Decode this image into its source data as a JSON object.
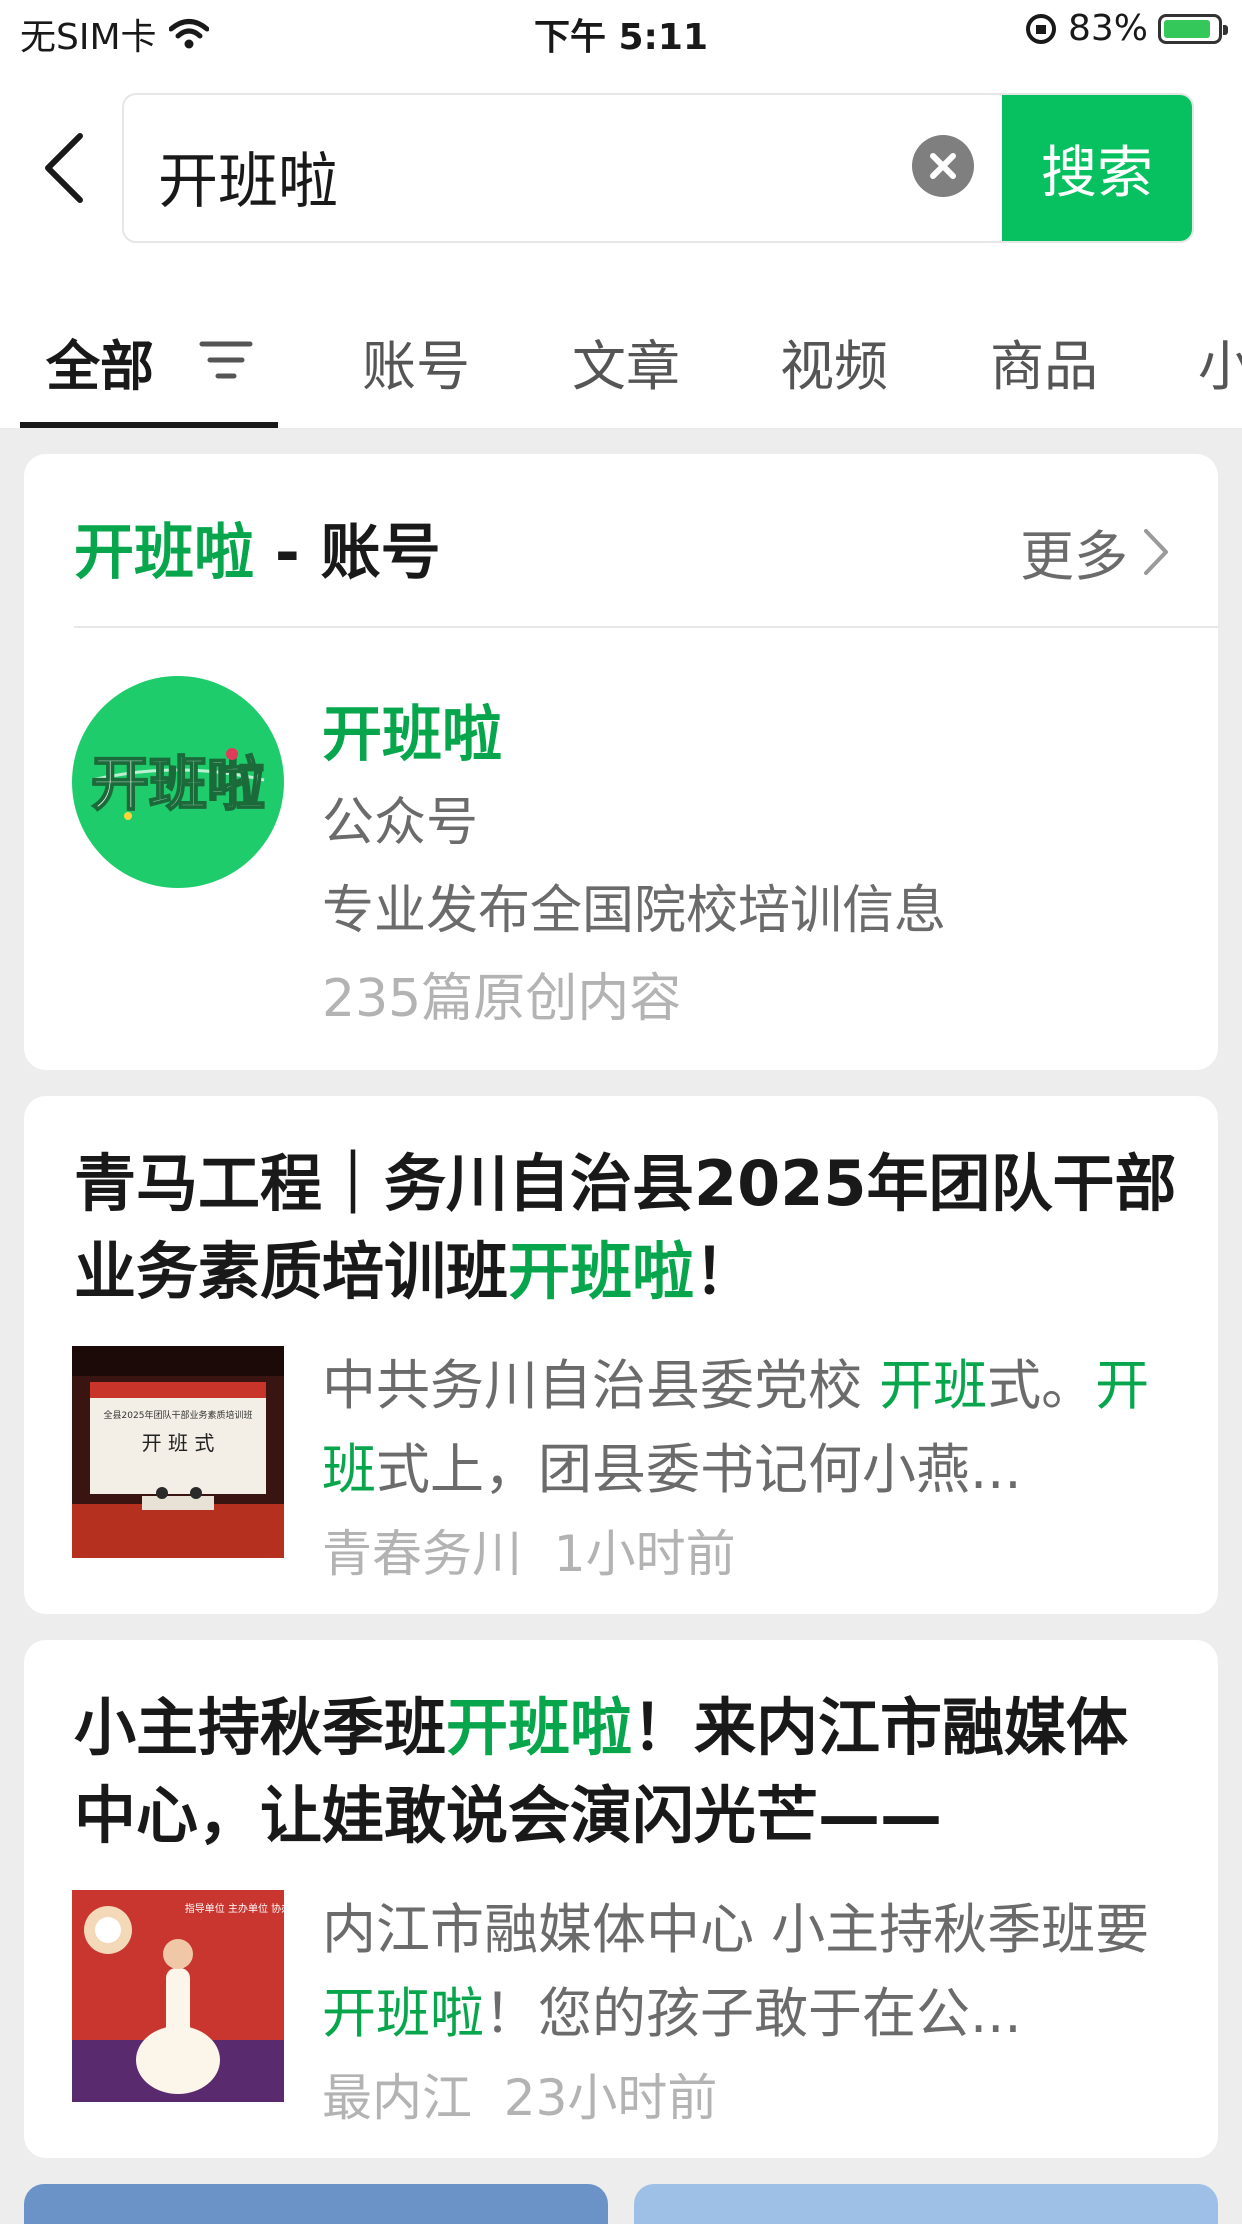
{
  "status_bar": {
    "carrier": "无SIM卡",
    "time": "下午 5:11",
    "battery": "83%"
  },
  "search": {
    "query": "开班啦",
    "button_label": "搜索"
  },
  "tabs": [
    "全部",
    "账号",
    "文章",
    "视频",
    "商品",
    "小"
  ],
  "account_section": {
    "keyword": "开班啦",
    "suffix": " - 账号",
    "more_label": "更多",
    "name": "开班啦",
    "type": "公众号",
    "description": "专业发布全国院校培训信息",
    "original_count": "235篇原创内容",
    "avatar_text": "开班啦"
  },
  "articles": [
    {
      "title_pre": "青马工程｜务川自治县2025年团队干部业务素质培训班",
      "title_hl": "开班啦",
      "title_post": "！",
      "snippet_a": "中共务川自治县委党校 ",
      "snippet_hl1": "开班",
      "snippet_b": "式。",
      "snippet_hl2": "开班",
      "snippet_c": "式上，团县委书记何小燕...",
      "source": "青春务川",
      "time": "1小时前",
      "thumb_text": "开 班 式",
      "thumb_banner": "全县2025年团队干部业务素质培训班"
    },
    {
      "title_pre": "小主持秋季班",
      "title_hl": "开班啦",
      "title_post": "！来内江市融媒体中心，让娃敢说会演闪光芒——",
      "snippet_a": "内江市融媒体中心 小主持秋季班要",
      "snippet_hl1": "开班啦",
      "snippet_b": "！您的孩子敢于在公...",
      "source": "最内江",
      "time": "23小时前",
      "thumb_text": "指导单位 主办单位 协办单位"
    }
  ],
  "colors": {
    "accent": "#07c160",
    "highlight": "#07a64c",
    "background": "#ededed"
  }
}
